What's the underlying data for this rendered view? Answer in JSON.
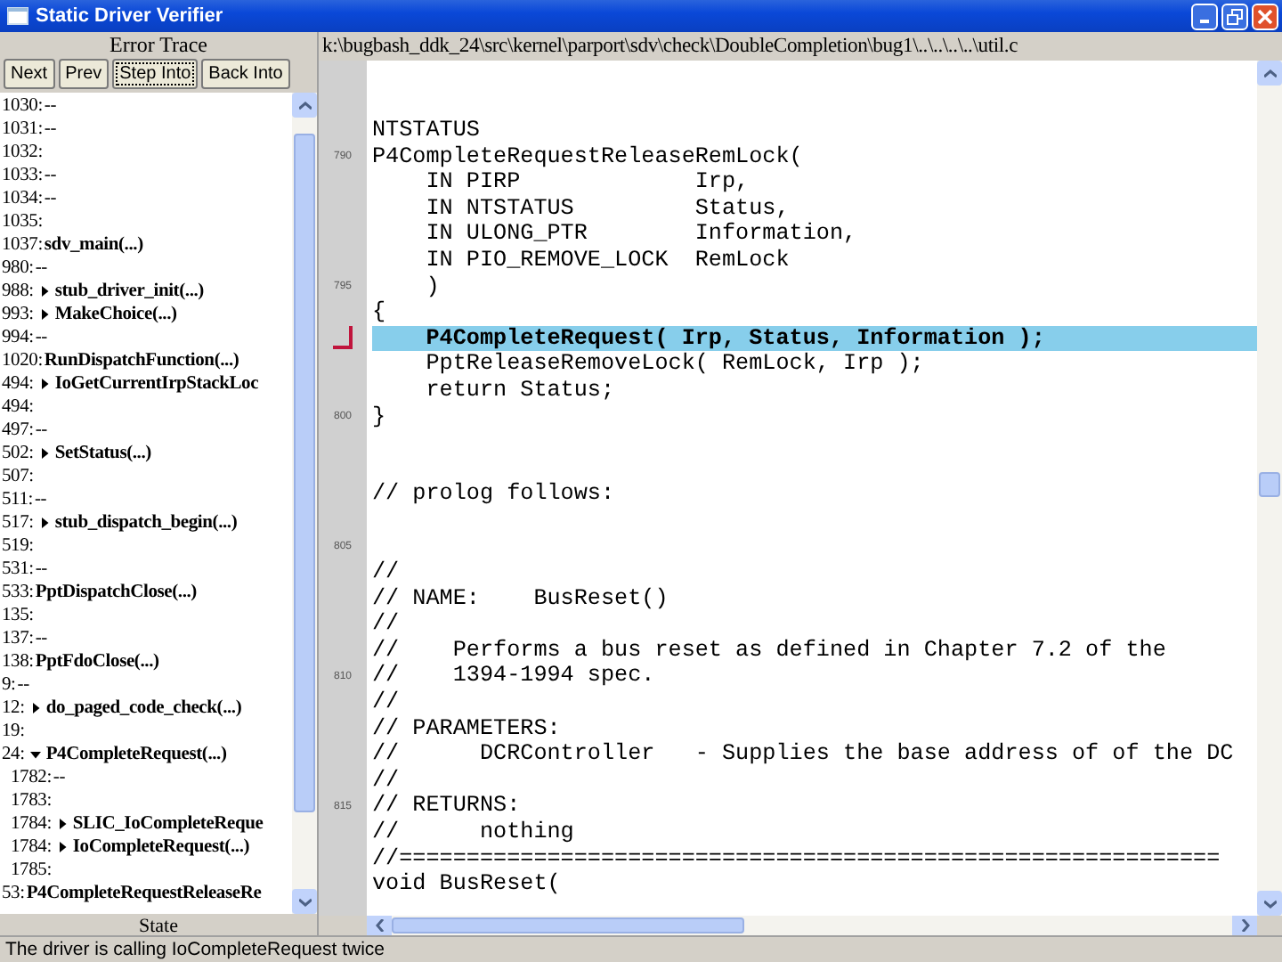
{
  "window": {
    "title": "Static Driver Verifier"
  },
  "error_trace": {
    "title": "Error Trace",
    "buttons": [
      {
        "label": "Next",
        "focused": false
      },
      {
        "label": "Prev",
        "focused": false
      },
      {
        "label": "Step Into",
        "focused": true
      },
      {
        "label": "Back Into",
        "focused": false
      }
    ],
    "items": [
      {
        "kind": "step",
        "line": "1030:",
        "text": "--"
      },
      {
        "kind": "step",
        "line": "1031:",
        "text": "--"
      },
      {
        "kind": "step",
        "line": "1032:"
      },
      {
        "kind": "step",
        "line": "1033:",
        "text": "--"
      },
      {
        "kind": "step",
        "line": "1034:",
        "text": "--"
      },
      {
        "kind": "step",
        "line": "1035:"
      },
      {
        "kind": "call",
        "line": "1037:",
        "text": "sdv_main(...)"
      },
      {
        "kind": "step",
        "line": "980:",
        "text": "--"
      },
      {
        "kind": "toggle",
        "line": "988:",
        "text": "stub_driver_init(...)",
        "expanded": false
      },
      {
        "kind": "toggle",
        "line": "993:",
        "text": "MakeChoice(...)",
        "expanded": false
      },
      {
        "kind": "step",
        "line": "994:",
        "text": "--"
      },
      {
        "kind": "call",
        "line": "1020:",
        "text": "RunDispatchFunction(...)"
      },
      {
        "kind": "toggle",
        "line": "494:",
        "text": "IoGetCurrentIrpStackLoc",
        "expanded": false
      },
      {
        "kind": "step",
        "line": "494:"
      },
      {
        "kind": "step",
        "line": "497:",
        "text": "--"
      },
      {
        "kind": "toggle",
        "line": "502:",
        "text": "SetStatus(...)",
        "expanded": false
      },
      {
        "kind": "step",
        "line": "507:"
      },
      {
        "kind": "step",
        "line": "511:",
        "text": "--"
      },
      {
        "kind": "toggle",
        "line": "517:",
        "text": "stub_dispatch_begin(...)",
        "expanded": false
      },
      {
        "kind": "step",
        "line": "519:"
      },
      {
        "kind": "step",
        "line": "531:",
        "text": "--"
      },
      {
        "kind": "call",
        "line": "533:",
        "text": "PptDispatchClose(...)"
      },
      {
        "kind": "step",
        "line": "135:"
      },
      {
        "kind": "step",
        "line": "137:",
        "text": "--"
      },
      {
        "kind": "call",
        "line": "138:",
        "text": "PptFdoClose(...)"
      },
      {
        "kind": "step",
        "line": "9:",
        "text": "--"
      },
      {
        "kind": "toggle",
        "line": "12:",
        "text": "do_paged_code_check(...)",
        "expanded": false
      },
      {
        "kind": "step",
        "line": "19:"
      },
      {
        "kind": "toggle",
        "line": "24:",
        "text": "P4CompleteRequest(...)",
        "expanded": true,
        "children": [
          {
            "kind": "step",
            "line": "1782:",
            "text": "--"
          },
          {
            "kind": "step",
            "line": "1783:"
          },
          {
            "kind": "toggle",
            "line": "1784:",
            "text": "SLIC_IoCompleteReque",
            "expanded": false
          },
          {
            "kind": "toggle",
            "line": "1784:",
            "text": "IoCompleteRequest(...)",
            "expanded": false
          },
          {
            "kind": "step",
            "line": "1785:"
          }
        ]
      },
      {
        "kind": "call",
        "line": "53:",
        "text": "P4CompleteRequestReleaseRe"
      }
    ]
  },
  "state": {
    "title": "State"
  },
  "source": {
    "path": "k:\\bugbash_ddk_24\\src\\kernel\\parport\\sdv\\check\\DoubleCompletion\\bug1\\..\\..\\..\\..\\util.c",
    "lines": [
      {
        "text": "NTSTATUS",
        "selected": false
      },
      {
        "number": "790",
        "text": "P4CompleteRequestReleaseRemLock(",
        "selected": false
      },
      {
        "text": "    IN PIRP             Irp,",
        "selected": false
      },
      {
        "text": "    IN NTSTATUS         Status,",
        "selected": false
      },
      {
        "text": "    IN ULONG_PTR        Information,",
        "selected": false
      },
      {
        "text": "    IN PIO_REMOVE_LOCK  RemLock",
        "selected": false
      },
      {
        "number": "795",
        "text": "    )",
        "selected": false
      },
      {
        "text": "{",
        "selected": false
      },
      {
        "text": "    P4CompleteRequest( Irp, Status, Information );",
        "selected": true
      },
      {
        "text": "    PptReleaseRemoveLock( RemLock, Irp );",
        "selected": false
      },
      {
        "text": "    return Status;",
        "selected": false
      },
      {
        "number": "800",
        "text": "}",
        "selected": false
      },
      {
        "selected": false
      },
      {
        "selected": false
      },
      {
        "text": "// prolog follows:",
        "selected": false
      },
      {
        "selected": false
      },
      {
        "number": "805",
        "selected": false
      },
      {
        "text": "//",
        "selected": false
      },
      {
        "text": "// NAME:    BusReset()",
        "selected": false
      },
      {
        "text": "//",
        "selected": false
      },
      {
        "text": "//    Performs a bus reset as defined in Chapter 7.2 of the",
        "selected": false
      },
      {
        "number": "810",
        "text": "//    1394-1994 spec.",
        "selected": false
      },
      {
        "text": "//",
        "selected": false
      },
      {
        "text": "// PARAMETERS:",
        "selected": false
      },
      {
        "text": "//      DCRController   - Supplies the base address of of the DC",
        "selected": false
      },
      {
        "text": "//",
        "selected": false
      },
      {
        "number": "815",
        "text": "// RETURNS:",
        "selected": false
      },
      {
        "text": "//      nothing",
        "selected": false
      },
      {
        "text": "//=============================================================",
        "selected": false
      },
      {
        "text": "void BusReset(",
        "selected": false
      }
    ]
  },
  "status_bar": {
    "text": "The driver is calling IoCompleteRequest twice"
  }
}
